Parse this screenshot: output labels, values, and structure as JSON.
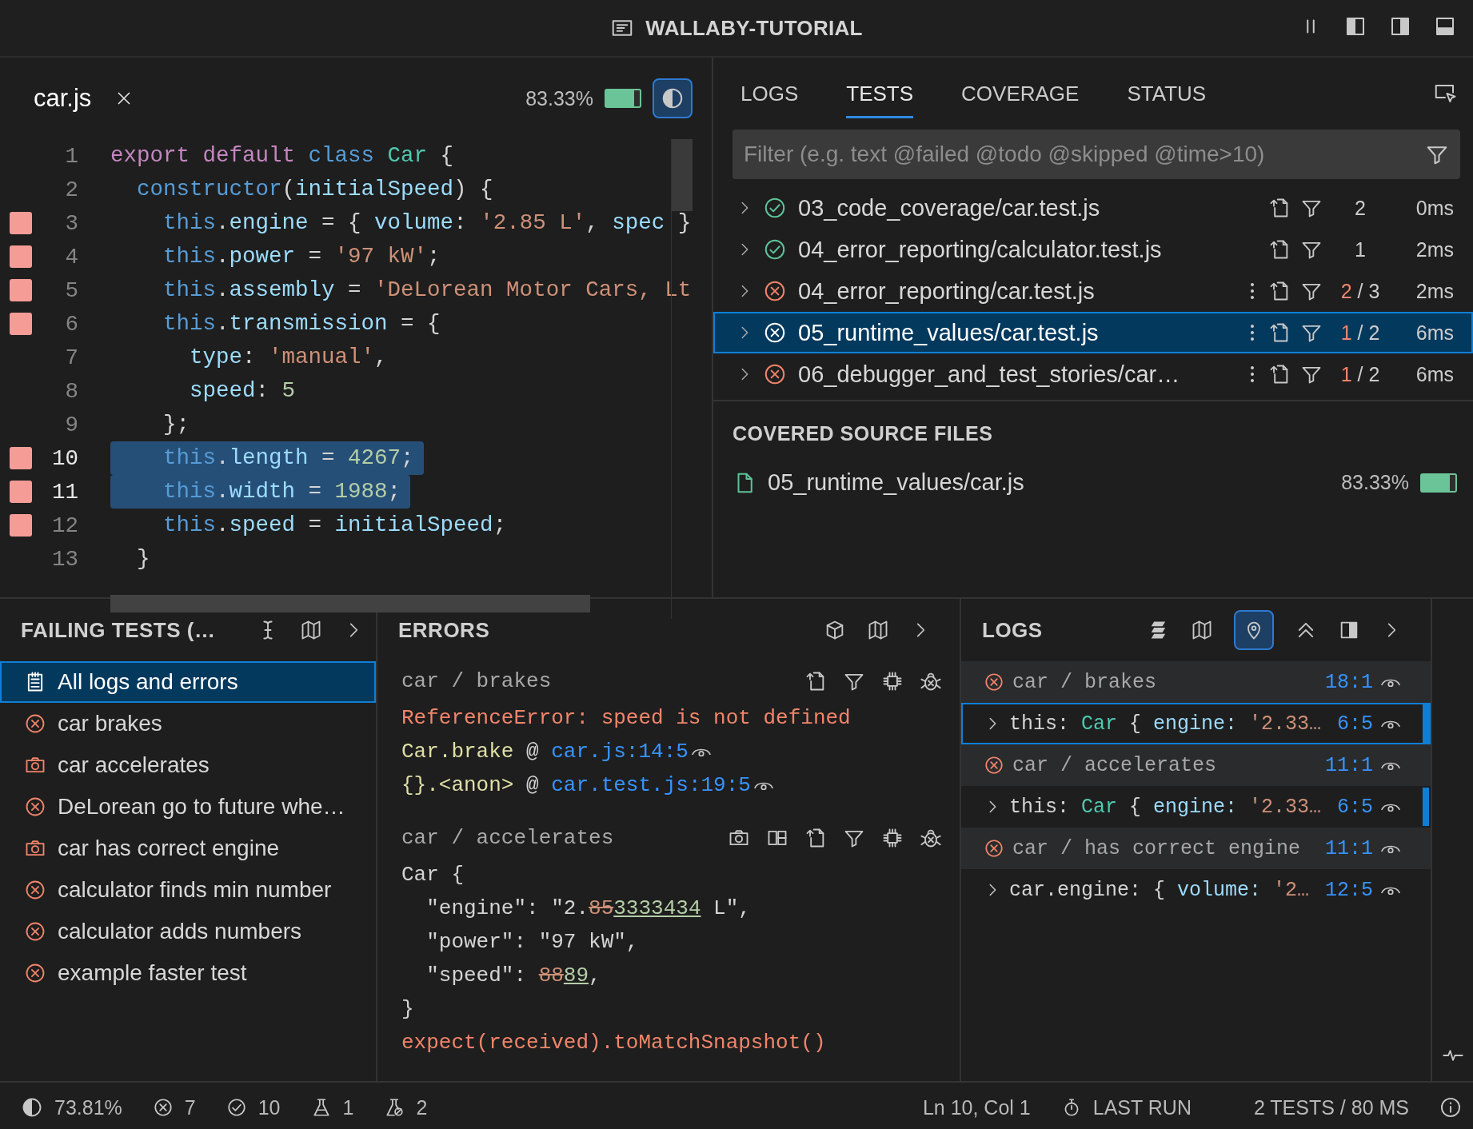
{
  "window": {
    "title": "WALLABY-TUTORIAL"
  },
  "editor": {
    "file": "car.js",
    "coverage": "83.33%",
    "level": 0.8333,
    "coverage_toggle_on": true,
    "lines": [
      {
        "number": "1",
        "uncovered": false,
        "selected": false,
        "tokens": [
          {
            "kind": "keyword",
            "text": "export"
          },
          {
            "kind": "keyword",
            "text": " default"
          },
          {
            "kind": "storage",
            "text": " class"
          },
          {
            "kind": "type",
            "text": " Car"
          },
          {
            "kind": "plain",
            "text": " {"
          }
        ]
      },
      {
        "number": "2",
        "uncovered": false,
        "selected": false,
        "tokens": [
          {
            "kind": "storage",
            "text": "  constructor"
          },
          {
            "kind": "plain",
            "text": "("
          },
          {
            "kind": "prop",
            "text": "initialSpeed"
          },
          {
            "kind": "plain",
            "text": ") {"
          }
        ]
      },
      {
        "number": "3",
        "uncovered": true,
        "selected": false,
        "tokens": [
          {
            "kind": "storage",
            "text": "    this"
          },
          {
            "kind": "plain",
            "text": "."
          },
          {
            "kind": "prop",
            "text": "engine"
          },
          {
            "kind": "plain",
            "text": " = { "
          },
          {
            "kind": "prop",
            "text": "volume"
          },
          {
            "kind": "plain",
            "text": ": "
          },
          {
            "kind": "string",
            "text": "'2.85 L'"
          },
          {
            "kind": "plain",
            "text": ", "
          },
          {
            "kind": "prop",
            "text": "spec"
          },
          {
            "kind": "plain",
            "text": " }"
          }
        ]
      },
      {
        "number": "4",
        "uncovered": true,
        "selected": false,
        "tokens": [
          {
            "kind": "storage",
            "text": "    this"
          },
          {
            "kind": "plain",
            "text": "."
          },
          {
            "kind": "prop",
            "text": "power"
          },
          {
            "kind": "plain",
            "text": " = "
          },
          {
            "kind": "string",
            "text": "'97 kW'"
          },
          {
            "kind": "plain",
            "text": ";"
          }
        ]
      },
      {
        "number": "5",
        "uncovered": true,
        "selected": false,
        "tokens": [
          {
            "kind": "storage",
            "text": "    this"
          },
          {
            "kind": "plain",
            "text": "."
          },
          {
            "kind": "prop",
            "text": "assembly"
          },
          {
            "kind": "plain",
            "text": " = "
          },
          {
            "kind": "string",
            "text": "'DeLorean Motor Cars, Lt"
          }
        ]
      },
      {
        "number": "6",
        "uncovered": true,
        "selected": false,
        "tokens": [
          {
            "kind": "storage",
            "text": "    this"
          },
          {
            "kind": "plain",
            "text": "."
          },
          {
            "kind": "prop",
            "text": "transmission"
          },
          {
            "kind": "plain",
            "text": " = {"
          }
        ]
      },
      {
        "number": "7",
        "uncovered": false,
        "selected": false,
        "tokens": [
          {
            "kind": "prop",
            "text": "      type"
          },
          {
            "kind": "plain",
            "text": ": "
          },
          {
            "kind": "string",
            "text": "'manual'"
          },
          {
            "kind": "plain",
            "text": ","
          }
        ]
      },
      {
        "number": "8",
        "uncovered": false,
        "selected": false,
        "tokens": [
          {
            "kind": "prop",
            "text": "      speed"
          },
          {
            "kind": "plain",
            "text": ": "
          },
          {
            "kind": "number",
            "text": "5"
          }
        ]
      },
      {
        "number": "9",
        "uncovered": false,
        "selected": false,
        "tokens": [
          {
            "kind": "plain",
            "text": "    };"
          }
        ]
      },
      {
        "number": "10",
        "uncovered": true,
        "selected": true,
        "tokens": [
          {
            "kind": "storage",
            "text": "    this"
          },
          {
            "kind": "plain",
            "text": "."
          },
          {
            "kind": "prop",
            "text": "length"
          },
          {
            "kind": "plain",
            "text": " = "
          },
          {
            "kind": "number",
            "text": "4267"
          },
          {
            "kind": "plain",
            "text": ";"
          }
        ]
      },
      {
        "number": "11",
        "uncovered": true,
        "selected": true,
        "tokens": [
          {
            "kind": "storage",
            "text": "    this"
          },
          {
            "kind": "plain",
            "text": "."
          },
          {
            "kind": "prop",
            "text": "width"
          },
          {
            "kind": "plain",
            "text": " = "
          },
          {
            "kind": "number",
            "text": "1988"
          },
          {
            "kind": "plain",
            "text": ";"
          }
        ]
      },
      {
        "number": "12",
        "uncovered": true,
        "selected": false,
        "tokens": [
          {
            "kind": "storage",
            "text": "    this"
          },
          {
            "kind": "plain",
            "text": "."
          },
          {
            "kind": "prop",
            "text": "speed"
          },
          {
            "kind": "plain",
            "text": " = "
          },
          {
            "kind": "prop",
            "text": "initialSpeed"
          },
          {
            "kind": "plain",
            "text": ";"
          }
        ]
      },
      {
        "number": "13",
        "uncovered": false,
        "selected": false,
        "tokens": [
          {
            "kind": "plain",
            "text": "  }"
          }
        ]
      }
    ]
  },
  "tabs": [
    {
      "label": "LOGS",
      "selected": false
    },
    {
      "label": "TESTS",
      "selected": true
    },
    {
      "label": "COVERAGE",
      "selected": false
    },
    {
      "label": "STATUS",
      "selected": false
    }
  ],
  "filter": {
    "placeholder": "Filter (e.g. text @failed @todo @skipped @time>10)"
  },
  "tests": [
    {
      "kind": "passed",
      "name": "03_code_coverage/car.test.js",
      "menu": false,
      "count": "2",
      "time": "0ms",
      "selected": false
    },
    {
      "kind": "passed",
      "name": "04_error_reporting/calculator.test.js",
      "menu": false,
      "count": "1",
      "time": "2ms",
      "selected": false
    },
    {
      "kind": "failed",
      "name": "04_error_reporting/car.test.js",
      "menu": true,
      "failed": "2",
      "total": "/ 3",
      "time": "2ms",
      "selected": false
    },
    {
      "kind": "failed",
      "name": "05_runtime_values/car.test.js",
      "menu": true,
      "failed": "1",
      "total": "/ 2",
      "time": "6ms",
      "selected": true
    },
    {
      "kind": "failed",
      "name": "06_debugger_and_test_stories/car…",
      "menu": true,
      "failed": "1",
      "total": "/ 2",
      "time": "6ms",
      "selected": false
    }
  ],
  "covered_files": {
    "title": "COVERED SOURCE FILES",
    "files": [
      {
        "name": "05_runtime_values/car.js",
        "coverage": "83.33%",
        "level": 0.8333
      }
    ]
  },
  "failing_tests": {
    "title": "FAILING TESTS (…",
    "items": [
      {
        "kind": "all",
        "label": "All logs and errors",
        "selected": true
      },
      {
        "kind": "error",
        "label": "car brakes",
        "selected": false
      },
      {
        "kind": "snapshot",
        "label": "car accelerates",
        "selected": false
      },
      {
        "kind": "error",
        "label": "DeLorean go to future whe…",
        "selected": false
      },
      {
        "kind": "snapshot",
        "label": "car has correct engine",
        "selected": false
      },
      {
        "kind": "error",
        "label": "calculator finds min number",
        "selected": false
      },
      {
        "kind": "error",
        "label": "calculator adds numbers",
        "selected": false
      },
      {
        "kind": "error",
        "label": "example faster test",
        "selected": false
      }
    ]
  },
  "errors": {
    "title": "ERRORS",
    "groups": [
      {
        "test": "car / brakes",
        "snapshot": false,
        "lines": [
          {
            "kind": "message",
            "text": "ReferenceError: speed is not defined"
          },
          {
            "kind": "stack",
            "func": "Car.brake",
            "at": "@",
            "link": "car.js:14:5"
          },
          {
            "kind": "stack",
            "func": "{}.<anon>",
            "at": "@",
            "link": "car.test.js:19:5"
          }
        ]
      },
      {
        "test": "car / accelerates",
        "snapshot": true,
        "lines": [
          {
            "kind": "diff",
            "parts": [
              {
                "kind": "plain",
                "text": "Car {"
              }
            ]
          },
          {
            "kind": "diff",
            "parts": [
              {
                "kind": "plain",
                "text": "  \"engine\": \"2."
              },
              {
                "kind": "removed",
                "text": "85"
              },
              {
                "kind": "added",
                "text": "3333434"
              },
              {
                "kind": "plain",
                "text": " L\","
              }
            ]
          },
          {
            "kind": "diff",
            "parts": [
              {
                "kind": "plain",
                "text": "  \"power\": \"97 kW\","
              }
            ]
          },
          {
            "kind": "diff",
            "parts": [
              {
                "kind": "plain",
                "text": "  \"speed\": "
              },
              {
                "kind": "removed",
                "text": "88"
              },
              {
                "kind": "added",
                "text": "89"
              },
              {
                "kind": "plain",
                "text": ","
              }
            ]
          },
          {
            "kind": "diff",
            "parts": [
              {
                "kind": "plain",
                "text": "}"
              }
            ]
          },
          {
            "kind": "message",
            "text": "expect(received).toMatchSnapshot()"
          }
        ]
      }
    ]
  },
  "logs": {
    "title": "LOGS",
    "pin_on": true,
    "rows": [
      {
        "kind": "test",
        "name": "car / brakes",
        "location": "18:1",
        "selected": false,
        "marked": false
      },
      {
        "kind": "value",
        "tokens": [
          {
            "kind": "plain",
            "text": "this: "
          },
          {
            "kind": "type",
            "text": "Car"
          },
          {
            "kind": "plain",
            "text": " { "
          },
          {
            "kind": "prop",
            "text": "engine: "
          },
          {
            "kind": "string",
            "text": "'2.33…"
          }
        ],
        "location": "6:5",
        "selected": true,
        "marked": true
      },
      {
        "kind": "test",
        "name": "car / accelerates",
        "location": "11:1",
        "selected": false,
        "marked": false
      },
      {
        "kind": "value",
        "tokens": [
          {
            "kind": "plain",
            "text": "this: "
          },
          {
            "kind": "type",
            "text": "Car"
          },
          {
            "kind": "plain",
            "text": " { "
          },
          {
            "kind": "prop",
            "text": "engine: "
          },
          {
            "kind": "string",
            "text": "'2.33…"
          }
        ],
        "location": "6:5",
        "selected": false,
        "marked": true
      },
      {
        "kind": "test",
        "name": "car / has correct engine",
        "location": "11:1",
        "selected": false,
        "marked": false
      },
      {
        "kind": "value",
        "tokens": [
          {
            "kind": "plain",
            "text": "car.engine: "
          },
          {
            "kind": "plain",
            "text": "{ "
          },
          {
            "kind": "prop",
            "text": "volume: "
          },
          {
            "kind": "string",
            "text": "'2…"
          }
        ],
        "location": "12:5",
        "selected": false,
        "marked": false
      }
    ]
  },
  "status_bar": {
    "coverage": "73.81%",
    "failed": "7",
    "passed": "10",
    "todo": "1",
    "skipped": "2",
    "position": "Ln 10, Col 1",
    "last_run": "LAST RUN",
    "summary": "2 TESTS / 80 MS"
  }
}
